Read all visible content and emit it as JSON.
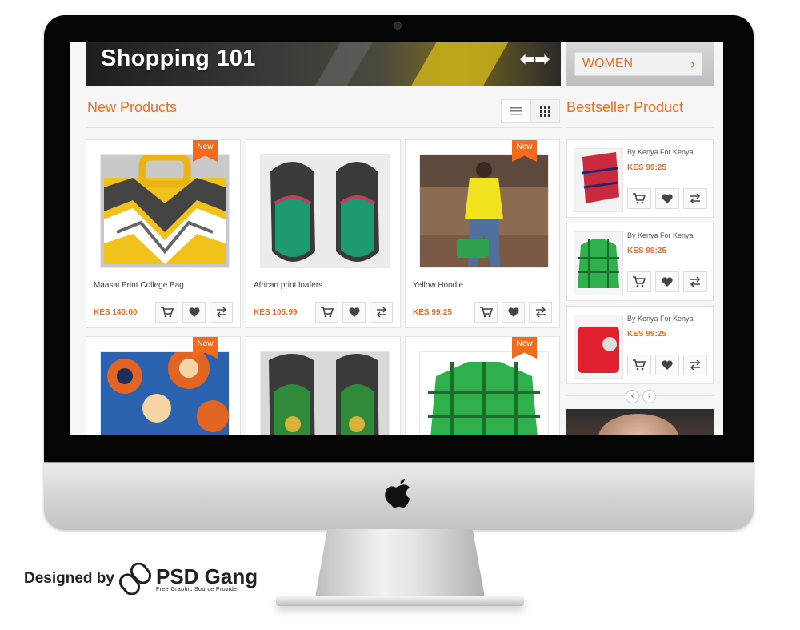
{
  "banner": {
    "title": "Shopping 101",
    "arrows": "⬅➡"
  },
  "side_banner": {
    "button_label": "WOMEN",
    "chevron": "›"
  },
  "new_products": {
    "title": "New Products",
    "view_modes": [
      "list-icon",
      "grid-icon"
    ],
    "items": [
      {
        "name": "Maasai Print College Bag",
        "price": "KES 140:00",
        "badge": "New"
      },
      {
        "name": "African print loafers",
        "price": "KES 105:99",
        "badge": ""
      },
      {
        "name": "Yellow Hoodie",
        "price": "KES 99:25",
        "badge": "New"
      },
      {
        "name": "",
        "price": "",
        "badge": "New"
      },
      {
        "name": "",
        "price": "",
        "badge": ""
      },
      {
        "name": "",
        "price": "",
        "badge": "New"
      }
    ]
  },
  "bestseller": {
    "title": "Bestseller Product",
    "items": [
      {
        "vendor": "By Kenya For Kenya",
        "price": "KES 99:25"
      },
      {
        "vendor": "By Kenya For Kenya",
        "price": "KES 99:25"
      },
      {
        "vendor": "By Kenya For Kenya",
        "price": "KES 99:25"
      }
    ],
    "pager": {
      "prev": "‹",
      "next": "›"
    }
  },
  "credit": {
    "label": "Designed by",
    "brand": "PSD Gang",
    "tagline": "Free Graphic Source Provider"
  },
  "colors": {
    "accent": "#f26b1d",
    "screen_bg": "#f6f6f6",
    "bezel": "#050505"
  }
}
